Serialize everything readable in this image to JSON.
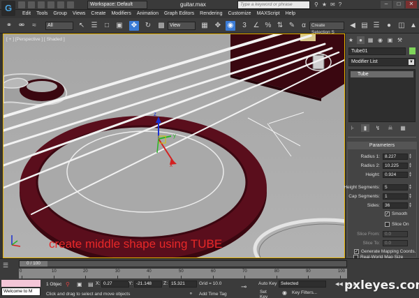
{
  "titlebar": {
    "workspace": "Workspace: Default",
    "file_title": "guitar.max",
    "search_placeholder": "Type a keyword or phrase",
    "logo": "G"
  },
  "menus": [
    "Edit",
    "Tools",
    "Group",
    "Views",
    "Create",
    "Modifiers",
    "Animation",
    "Graph Editors",
    "Rendering",
    "Customize",
    "MAXScript",
    "Help"
  ],
  "toolbar": {
    "selection_filter": "All",
    "reference_coord": "View",
    "named_selection": "Create Selection S"
  },
  "viewport": {
    "label": "[ + ] [Perspective ] [ Shaded ]",
    "caption": "create middle shape using TUBE",
    "caption_color": "#e82828"
  },
  "command_panel": {
    "object_name": "Tube01",
    "object_color": "#7fd45a",
    "modifier_list": "Modifier List",
    "stack_item": "Tube",
    "parameters": {
      "title": "Parameters",
      "radius1_label": "Radius 1:",
      "radius1": "8.227",
      "radius2_label": "Radius 2:",
      "radius2": "10.225",
      "height_label": "Height:",
      "height": "0.924",
      "height_segments_label": "Height Segments:",
      "height_segments": "5",
      "cap_segments_label": "Cap Segments:",
      "cap_segments": "1",
      "sides_label": "Sides:",
      "sides": "36",
      "smooth_label": "Smooth",
      "smooth": true,
      "slice_on_label": "Slice On",
      "slice_on": false,
      "slice_from_label": "Slice From:",
      "slice_from": "0.0",
      "slice_to_label": "Slice To:",
      "slice_to": "0.0",
      "gen_map_label": "Generate Mapping Coords.",
      "gen_map": true,
      "real_world_label": "Real-World Map Size",
      "real_world": false
    }
  },
  "timeline": {
    "frame": "0 / 100",
    "ticks": [
      "0",
      "10",
      "20",
      "30",
      "40",
      "50",
      "60",
      "70",
      "80",
      "90",
      "100"
    ]
  },
  "statusbar": {
    "maxscript": "Welcome to M",
    "object_count": "1 Objec",
    "prompt": "Click and drag to select and move objects",
    "x_label": "X:",
    "x": "0.27",
    "y_label": "Y:",
    "y": "-21.148",
    "z_label": "Z:",
    "z": "15.321",
    "grid": "Grid = 10.0",
    "add_time_tag": "Add Time Tag",
    "auto_key": "Auto Key",
    "set_key": "Set Key",
    "key_mode": "Selected",
    "key_filters": "Key Filters..."
  },
  "watermark": "pxleyes.com"
}
